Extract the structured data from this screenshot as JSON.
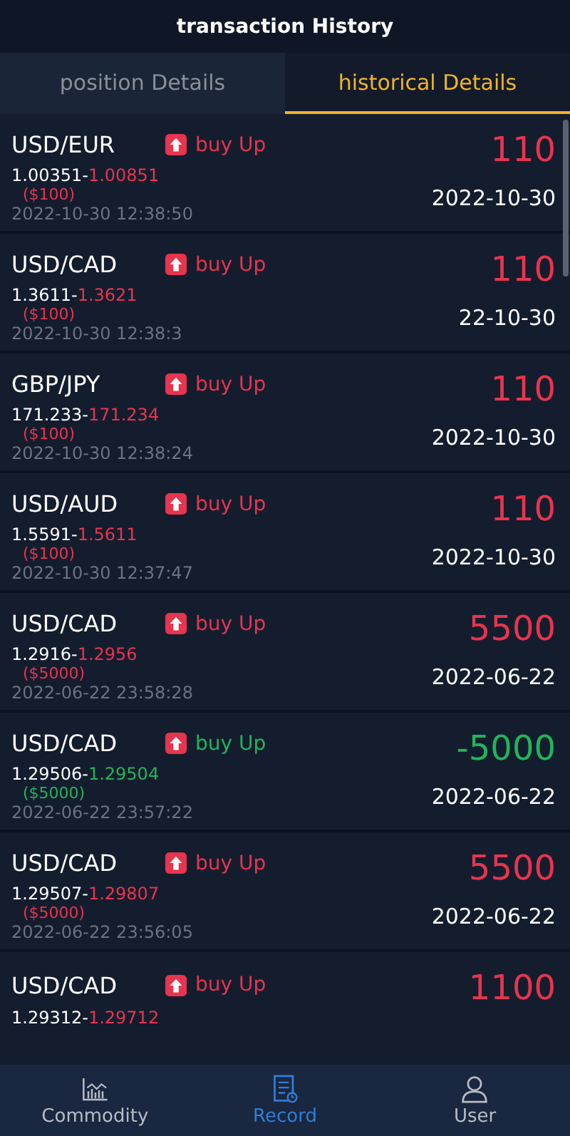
{
  "header": {
    "title": "transaction History"
  },
  "tabs": [
    {
      "label": "position Details",
      "selected": false
    },
    {
      "label": "historical Details",
      "selected": true
    }
  ],
  "trades": [
    {
      "pair": "USD/EUR",
      "direction": "buy Up",
      "profit": "110",
      "open_price": "1.00351-",
      "close_price": "1.00851",
      "amount": "($100)",
      "time": "2022-10-30 12:38:50",
      "date": "2022-10-30",
      "color": "#e8344e"
    },
    {
      "pair": "USD/CAD",
      "direction": "buy Up",
      "profit": "110",
      "open_price": "1.3611-",
      "close_price": "1.3621",
      "amount": "($100)",
      "time": "2022-10-30 12:38:3",
      "date": "22-10-30",
      "color": "#e8344e"
    },
    {
      "pair": "GBP/JPY",
      "direction": "buy Up",
      "profit": "110",
      "open_price": "171.233-",
      "close_price": "171.234",
      "amount": "($100)",
      "time": "2022-10-30 12:38:24",
      "date": "2022-10-30",
      "color": "#e8344e"
    },
    {
      "pair": "USD/AUD",
      "direction": "buy Up",
      "profit": "110",
      "open_price": "1.5591-",
      "close_price": "1.5611",
      "amount": "($100)",
      "time": "2022-10-30 12:37:47",
      "date": "2022-10-30",
      "color": "#e8344e"
    },
    {
      "pair": "USD/CAD",
      "direction": "buy Up",
      "profit": "5500",
      "open_price": "1.2916-",
      "close_price": "1.2956",
      "amount": "($5000)",
      "time": "2022-06-22 23:58:28",
      "date": "2022-06-22",
      "color": "#e8344e"
    },
    {
      "pair": "USD/CAD",
      "direction": "buy Up",
      "profit": "-5000",
      "open_price": "1.29506-",
      "close_price": "1.29504",
      "amount": "($5000)",
      "time": "2022-06-22 23:57:22",
      "date": "2022-06-22",
      "color": "#22b45a"
    },
    {
      "pair": "USD/CAD",
      "direction": "buy Up",
      "profit": "5500",
      "open_price": "1.29507-",
      "close_price": "1.29807",
      "amount": "($5000)",
      "time": "2022-06-22 23:56:05",
      "date": "2022-06-22",
      "color": "#e8344e"
    },
    {
      "pair": "USD/CAD",
      "direction": "buy Up",
      "profit": "1100",
      "open_price": "1.29312-",
      "close_price": "1.29712",
      "color": "#e8344e"
    }
  ],
  "nav": [
    {
      "kind": "chart",
      "label": "Commodity",
      "selected": false
    },
    {
      "kind": "record",
      "label": "Record",
      "selected": true
    },
    {
      "kind": "user",
      "label": "User",
      "selected": false
    }
  ]
}
